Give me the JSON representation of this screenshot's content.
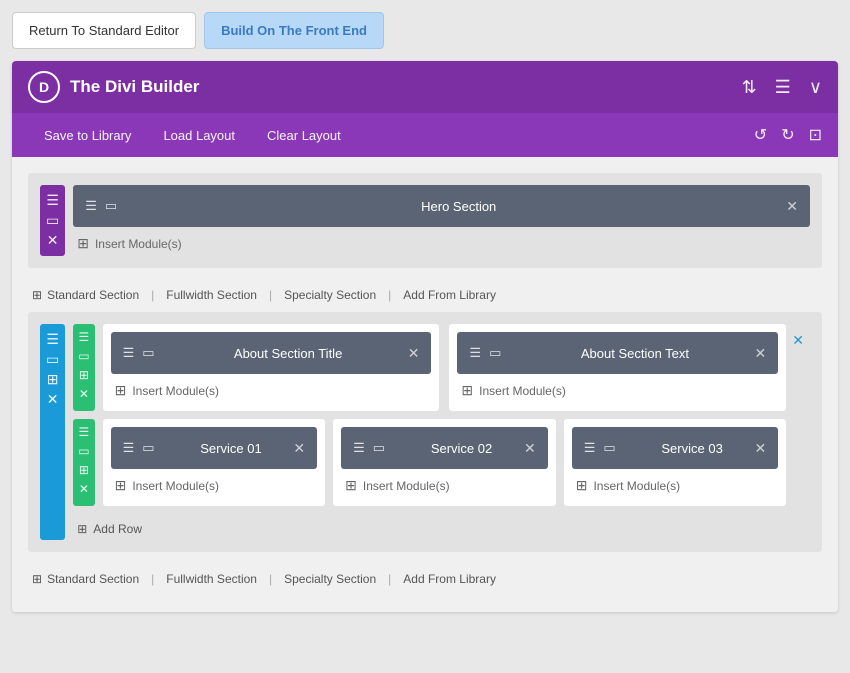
{
  "topBar": {
    "standardEditorBtn": "Return To Standard Editor",
    "frontEndBtn": "Build On The Front End"
  },
  "builder": {
    "logo": "D",
    "title": "The Divi Builder",
    "headerIcons": {
      "sort": "⇅",
      "menu": "☰",
      "chevron": "∨"
    },
    "toolbar": {
      "saveLabel": "Save to Library",
      "loadLabel": "Load Layout",
      "clearLabel": "Clear Layout",
      "undoIcon": "↺",
      "redoIcon": "↻",
      "historyIcon": "⊡"
    }
  },
  "sections": {
    "heroSection": {
      "label": "Hero Section",
      "insertLabel": "Insert Module(s)"
    },
    "sectionFooter1": {
      "standardSection": "Standard Section",
      "fullwidthSection": "Fullwidth Section",
      "specialtySection": "Specialty Section",
      "addFromLibrary": "Add From Library"
    },
    "specialtySection": {
      "rows": [
        {
          "columns": [
            {
              "label": "About Section Title",
              "insertLabel": "Insert Module(s)"
            },
            {
              "label": "About Section Text",
              "insertLabel": "Insert Module(s)"
            }
          ]
        },
        {
          "columns": [
            {
              "label": "Service 01",
              "insertLabel": "Insert Module(s)"
            },
            {
              "label": "Service 02",
              "insertLabel": "Insert Module(s)"
            },
            {
              "label": "Service 03",
              "insertLabel": "Insert Module(s)"
            }
          ]
        }
      ],
      "addRow": "Add Row"
    },
    "sectionFooter2": {
      "standardSection": "Standard Section",
      "fullwidthSection": "Fullwidth Section",
      "specialtySection": "Specialty Section",
      "addFromLibrary": "Add From Library"
    }
  }
}
